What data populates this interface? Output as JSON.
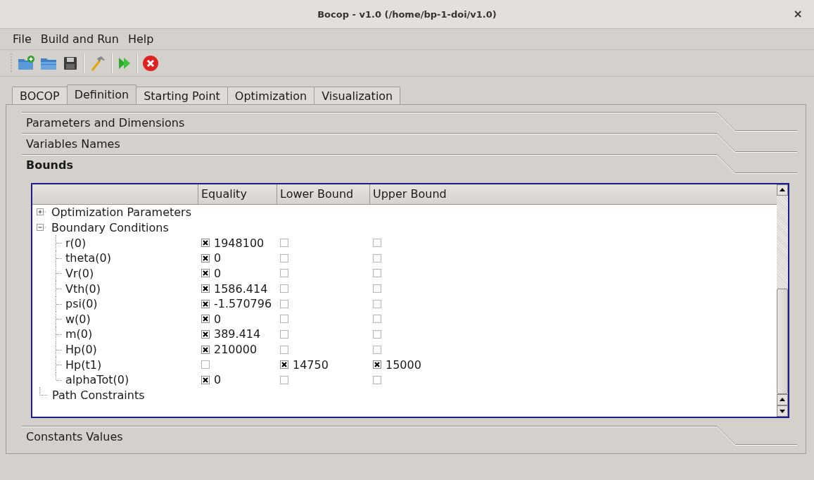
{
  "window": {
    "title": "Bocop - v1.0 (/home/bp-1-doi/v1.0)",
    "close": "×"
  },
  "menu": [
    "File",
    "Build and Run",
    "Help"
  ],
  "tabs": [
    {
      "label": "BOCOP",
      "selected": false
    },
    {
      "label": "Definition",
      "selected": true
    },
    {
      "label": "Starting Point",
      "selected": false
    },
    {
      "label": "Optimization",
      "selected": false
    },
    {
      "label": "Visualization",
      "selected": false
    }
  ],
  "sections": [
    {
      "title": "Parameters and Dimensions",
      "expanded": false
    },
    {
      "title": "Variables Names",
      "expanded": false
    },
    {
      "title": "Bounds",
      "expanded": true
    },
    {
      "title": "Constants Values",
      "expanded": false
    }
  ],
  "table": {
    "columns": [
      "Equality",
      "Lower Bound",
      "Upper Bound"
    ],
    "rows": [
      {
        "label": "Optimization Parameters",
        "expanded": false,
        "children": []
      },
      {
        "label": "Boundary Conditions",
        "expanded": true,
        "children": [
          {
            "label": "r(0)",
            "cells": [
              {
                "checked": true,
                "value": "1948100"
              },
              {
                "checked": false
              },
              {
                "checked": false
              }
            ]
          },
          {
            "label": "theta(0)",
            "cells": [
              {
                "checked": true,
                "value": "0"
              },
              {
                "checked": false
              },
              {
                "checked": false
              }
            ]
          },
          {
            "label": "Vr(0)",
            "cells": [
              {
                "checked": true,
                "value": "0"
              },
              {
                "checked": false
              },
              {
                "checked": false
              }
            ]
          },
          {
            "label": "Vth(0)",
            "cells": [
              {
                "checked": true,
                "value": "1586.414"
              },
              {
                "checked": false
              },
              {
                "checked": false
              }
            ]
          },
          {
            "label": "psi(0)",
            "cells": [
              {
                "checked": true,
                "value": "-1.570796"
              },
              {
                "checked": false
              },
              {
                "checked": false
              }
            ]
          },
          {
            "label": "w(0)",
            "cells": [
              {
                "checked": true,
                "value": "0"
              },
              {
                "checked": false
              },
              {
                "checked": false
              }
            ]
          },
          {
            "label": "m(0)",
            "cells": [
              {
                "checked": true,
                "value": "389.414"
              },
              {
                "checked": false
              },
              {
                "checked": false
              }
            ]
          },
          {
            "label": "Hp(0)",
            "cells": [
              {
                "checked": true,
                "value": "210000"
              },
              {
                "checked": false
              },
              {
                "checked": false
              }
            ]
          },
          {
            "label": "Hp(t1)",
            "cells": [
              {
                "checked": false
              },
              {
                "checked": true,
                "value": "14750"
              },
              {
                "checked": true,
                "value": "15000"
              }
            ]
          },
          {
            "label": "alphaTot(0)",
            "cells": [
              {
                "checked": true,
                "value": "0"
              },
              {
                "checked": false
              },
              {
                "checked": false
              }
            ]
          }
        ]
      },
      {
        "label": "Path Constraints"
      }
    ]
  }
}
